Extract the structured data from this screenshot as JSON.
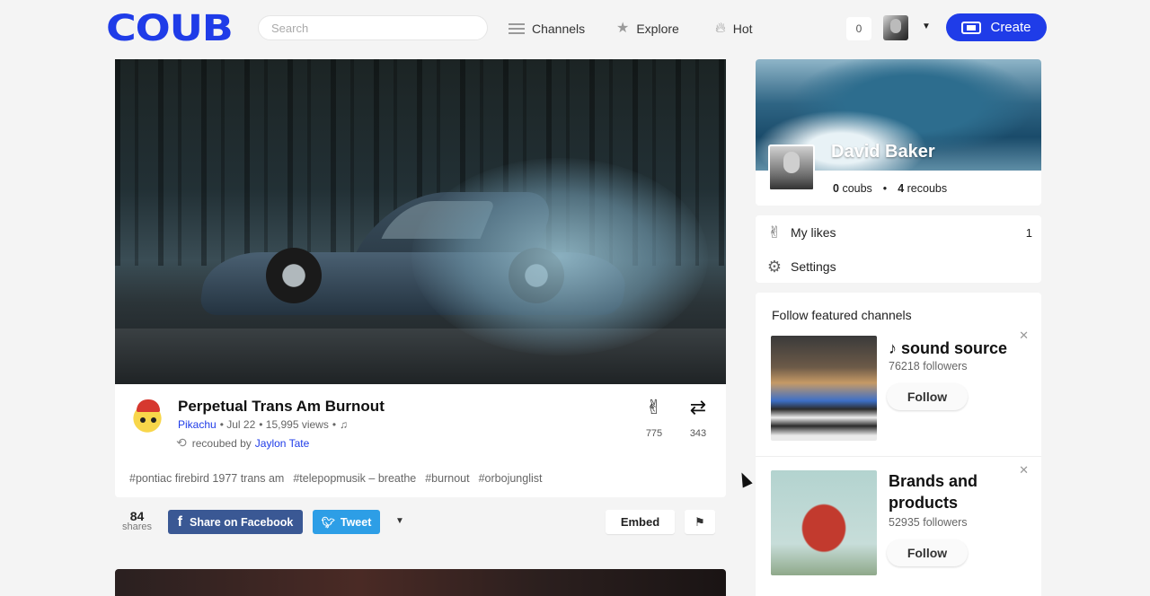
{
  "header": {
    "logo": "COUB",
    "search_placeholder": "Search",
    "nav": {
      "channels": "Channels",
      "explore": "Explore",
      "hot": "Hot"
    },
    "notifications_count": "0",
    "create_label": "Create"
  },
  "coub": {
    "title": "Perpetual Trans Am Burnout",
    "author": "Pikachu",
    "date": "• Jul 22",
    "views": "• 15,995 views",
    "music_sep": "•",
    "recoubed_by_label": "recoubed by",
    "recoubed_by": "Jaylon Tate",
    "likes": "775",
    "recoubs": "343",
    "tags": [
      "#pontiac firebird 1977 trans am",
      "#telepopmusik – breathe",
      "#burnout",
      "#orbojunglist"
    ]
  },
  "share": {
    "count": "84",
    "count_label": "shares",
    "facebook_label": "Share on Facebook",
    "twitter_label": "Tweet",
    "embed_label": "Embed"
  },
  "profile": {
    "name": "David Baker",
    "coubs_count": "0",
    "coubs_label": "coubs",
    "recoubs_count": "4",
    "recoubs_label": "recoubs"
  },
  "menu": {
    "likes_label": "My likes",
    "likes_count": "1",
    "settings_label": "Settings"
  },
  "featured": {
    "title": "Follow featured channels",
    "channels": [
      {
        "name": "♪ sound source",
        "followers": "76218 followers",
        "follow_label": "Follow"
      },
      {
        "name": "Brands and products",
        "followers": "52935 followers",
        "follow_label": "Follow"
      }
    ]
  },
  "colors": {
    "brand": "#1f3ce8",
    "facebook": "#3a5894",
    "twitter": "#2d9ee6"
  }
}
